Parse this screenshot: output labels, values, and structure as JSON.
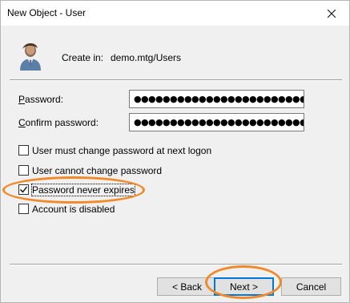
{
  "window": {
    "title": "New Object - User",
    "close_icon": "close-icon"
  },
  "header": {
    "icon": "user-icon",
    "create_in_label": "Create in:",
    "create_in_value": "demo.mtg/Users"
  },
  "form": {
    "password_label_prefix": "",
    "password_label_accel": "P",
    "password_label_rest": "assword:",
    "password_value": "●●●●●●●●●●●●●●●●●●●●●●●●●●●●●●●●●●●●",
    "confirm_label_accel": "C",
    "confirm_label_rest": "onfirm password:",
    "confirm_value": "●●●●●●●●●●●●●●●●●●●●●●●●●●●●●●●●●●●●"
  },
  "options": [
    {
      "label": "User must change password at next logon",
      "checked": false
    },
    {
      "label": "User cannot change password",
      "checked": false
    },
    {
      "label": "Password never expires",
      "checked": true
    },
    {
      "label": "Account is disabled",
      "checked": false
    }
  ],
  "buttons": {
    "back": "< Back",
    "next": "Next >",
    "cancel": "Cancel"
  },
  "colors": {
    "annotation": "#f08a2a",
    "default_button_border": "#0078d7"
  }
}
